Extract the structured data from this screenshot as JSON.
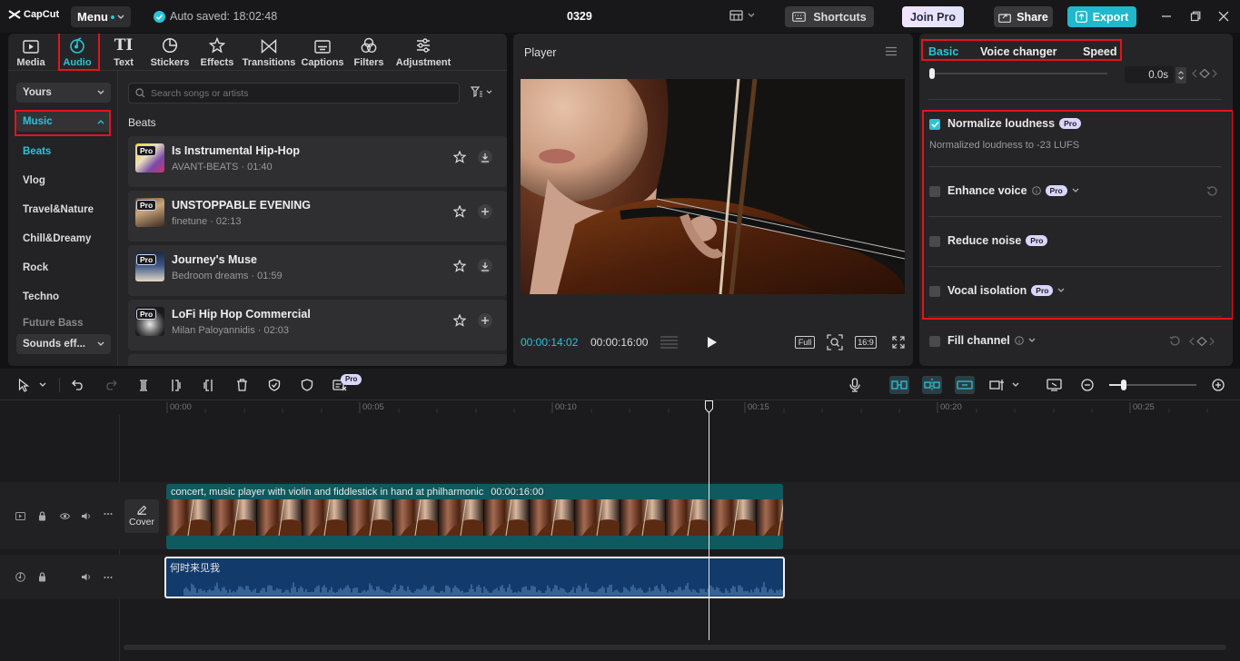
{
  "app": {
    "logo": "CapCut",
    "menu_label": "Menu",
    "autosave": "Auto saved: 18:02:48",
    "project_name": "0329",
    "shortcuts_label": "Shortcuts",
    "joinpro_label": "Join Pro",
    "share_label": "Share",
    "export_label": "Export"
  },
  "toolbar": {
    "items": [
      {
        "label": "Media",
        "icon": "media-icon"
      },
      {
        "label": "Audio",
        "icon": "audio-icon",
        "active": true
      },
      {
        "label": "Text",
        "icon": "text-icon"
      },
      {
        "label": "Stickers",
        "icon": "stickers-icon"
      },
      {
        "label": "Effects",
        "icon": "effects-icon"
      },
      {
        "label": "Transitions",
        "icon": "transitions-icon"
      },
      {
        "label": "Captions",
        "icon": "captions-icon"
      },
      {
        "label": "Filters",
        "icon": "filters-icon"
      },
      {
        "label": "Adjustment",
        "icon": "adjustment-icon"
      }
    ]
  },
  "sidebar": {
    "yours": "Yours",
    "music": "Music",
    "items": [
      "Beats",
      "Vlog",
      "Travel&Nature",
      "Chill&Dreamy",
      "Rock",
      "Techno",
      "Future Bass"
    ],
    "sounds": "Sounds eff..."
  },
  "library": {
    "search_placeholder": "Search songs or artists",
    "section_title": "Beats",
    "tracks": [
      {
        "title": "Is Instrumental Hip-Hop",
        "meta": "AVANT-BEATS · 01:40"
      },
      {
        "title": "UNSTOPPABLE EVENING",
        "meta": "finetune · 02:13"
      },
      {
        "title": "Journey's Muse",
        "meta": "Bedroom dreams · 01:59"
      },
      {
        "title": "LoFi Hip Hop Commercial",
        "meta": "Milan Paloyannidis · 02:03"
      }
    ],
    "pro_badge": "Pro"
  },
  "player": {
    "title": "Player",
    "current_time": "00:00:14:02",
    "total_time": "00:00:16:00",
    "full_label": "Full",
    "ratio_label": "16:9"
  },
  "settings": {
    "tabs": [
      "Basic",
      "Voice changer",
      "Speed"
    ],
    "speed_value": "0.0s",
    "normalize": {
      "label": "Normalize loudness",
      "sub": "Normalized loudness to -23 LUFS",
      "checked": true
    },
    "enhance": "Enhance voice",
    "reduce": "Reduce noise",
    "vocal": "Vocal isolation",
    "fill": "Fill channel",
    "pro_badge": "Pro"
  },
  "timeline": {
    "ruler": [
      "00:00",
      "00:05",
      "00:10",
      "00:15",
      "00:20",
      "00:25"
    ],
    "video_clip_title": "concert, music player with violin and fiddlestick in hand at philharmonic",
    "video_clip_duration": "00:00:16:00",
    "audio_clip_title": "何时来见我",
    "cover_label": "Cover",
    "pro_badge": "Pro"
  }
}
